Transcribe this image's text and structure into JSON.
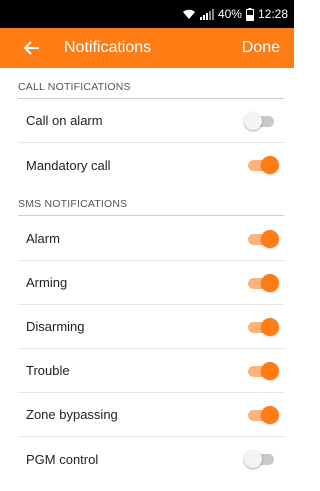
{
  "status_bar": {
    "battery_percent": "40%",
    "time": "12:28"
  },
  "app_bar": {
    "title": "Notifications",
    "done_label": "Done",
    "back_icon": "arrow-left-icon"
  },
  "colors": {
    "accent": "#ff7c14",
    "status_bar": "#000000"
  },
  "call_section": {
    "header": "CALL NOTIFICATIONS",
    "items": [
      {
        "label": "Call on alarm",
        "enabled": false
      },
      {
        "label": "Mandatory call",
        "enabled": true
      }
    ]
  },
  "sms_section": {
    "header": "SMS NOTIFICATIONS",
    "items": [
      {
        "label": "Alarm",
        "enabled": true
      },
      {
        "label": "Arming",
        "enabled": true
      },
      {
        "label": "Disarming",
        "enabled": true
      },
      {
        "label": "Trouble",
        "enabled": true
      },
      {
        "label": "Zone bypassing",
        "enabled": true
      },
      {
        "label": "PGM control",
        "enabled": false
      }
    ]
  }
}
